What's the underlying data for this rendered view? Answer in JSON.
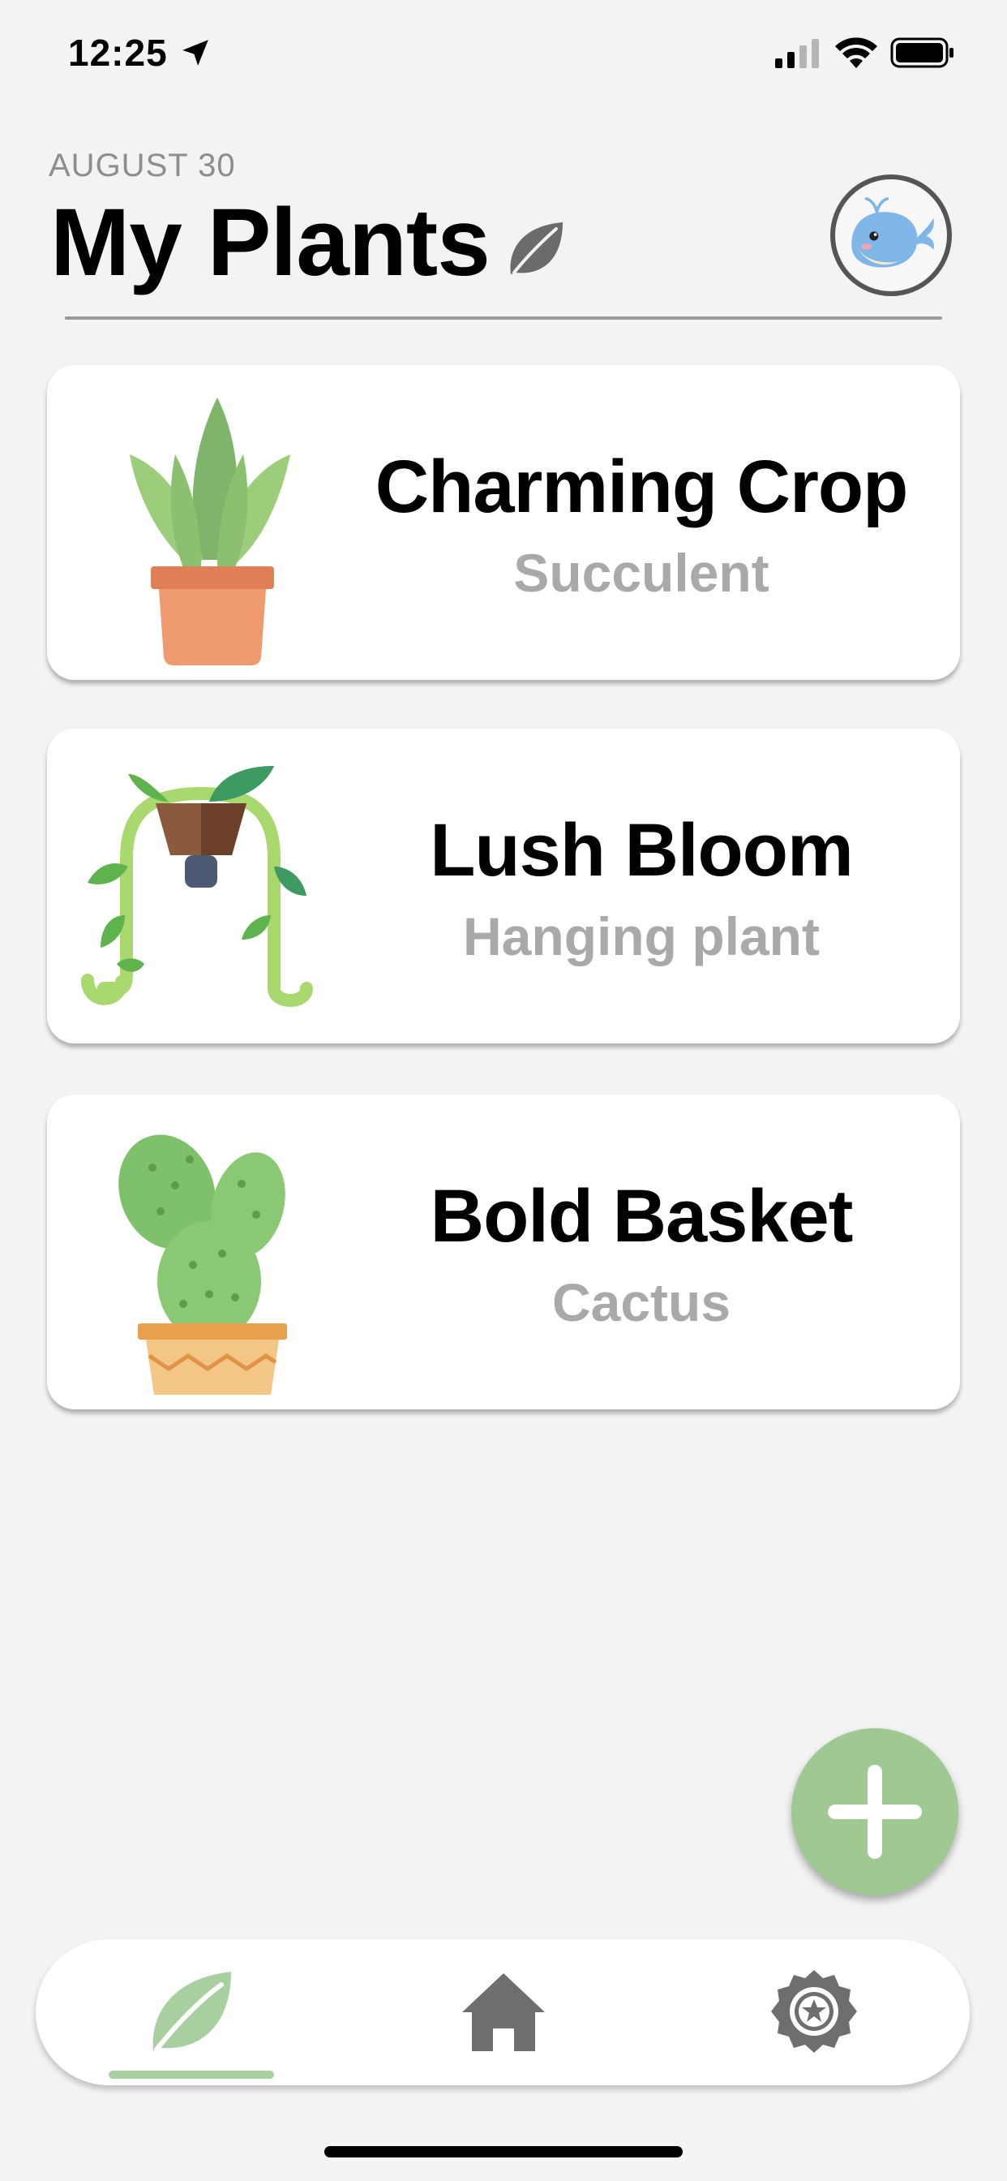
{
  "status_bar": {
    "time": "12:25"
  },
  "header": {
    "date": "AUGUST 30",
    "title": "My Plants"
  },
  "plants": [
    {
      "name": "Charming Crop",
      "type": "Succulent"
    },
    {
      "name": "Lush Bloom",
      "type": "Hanging plant"
    },
    {
      "name": "Bold Basket",
      "type": "Cactus"
    }
  ],
  "tab_bar": {
    "tabs": [
      {
        "icon": "leaf-icon",
        "selected": true
      },
      {
        "icon": "home-icon",
        "selected": false
      },
      {
        "icon": "settings-badge-icon",
        "selected": false
      }
    ]
  },
  "colors": {
    "accent": "#9fc893",
    "background": "#f3f3f3",
    "subtitle": "#a9a9a9"
  }
}
